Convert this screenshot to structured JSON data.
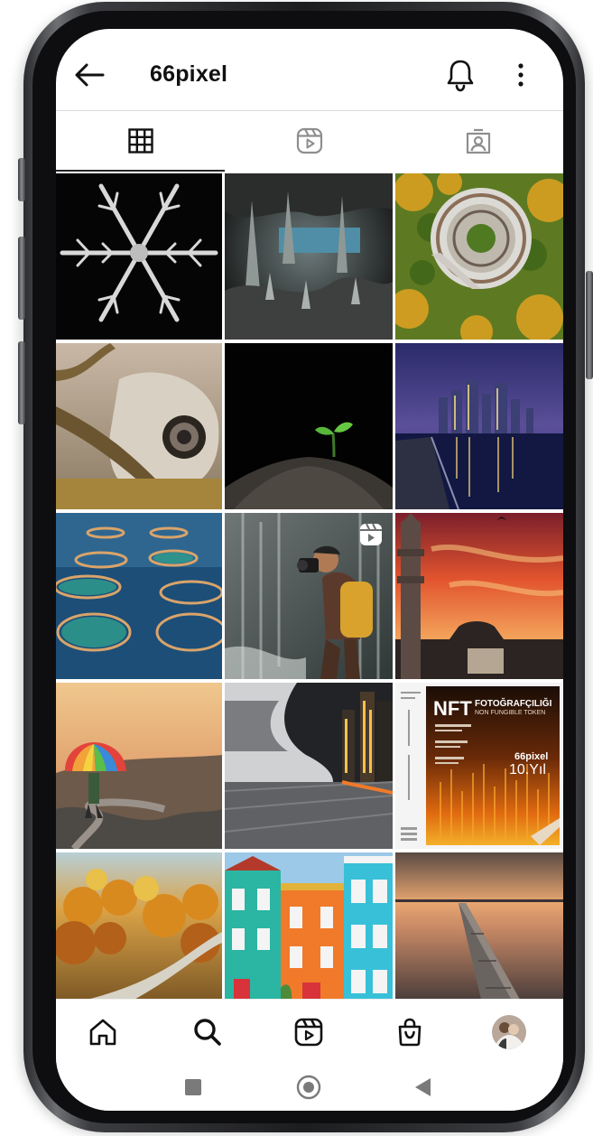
{
  "header": {
    "title": "66pixel",
    "back_icon": "arrow-left-icon",
    "notification_icon": "bell-icon",
    "more_icon": "more-vertical-icon"
  },
  "tabs": [
    {
      "name": "posts-grid",
      "icon": "grid-icon",
      "selected": true
    },
    {
      "name": "reels",
      "icon": "reels-icon",
      "selected": false
    },
    {
      "name": "tagged",
      "icon": "tagged-person-icon",
      "selected": false
    }
  ],
  "grid": {
    "posts": [
      {
        "subject": "snowflake"
      },
      {
        "subject": "underwater-cave"
      },
      {
        "subject": "aerial-round-building"
      },
      {
        "subject": "camouflaged-camera-lens"
      },
      {
        "subject": "seedling-in-dark"
      },
      {
        "subject": "city-skyline-night"
      },
      {
        "subject": "fish-farm-circles"
      },
      {
        "subject": "photographer-waterfall",
        "reel_icon": "reels-icon"
      },
      {
        "subject": "minaret-sunset"
      },
      {
        "subject": "rainbow-umbrella"
      },
      {
        "subject": "modern-architecture-night"
      },
      {
        "subject": "nft-magazine-cover"
      },
      {
        "subject": "autumn-road"
      },
      {
        "subject": "colorful-houses"
      },
      {
        "subject": "pier-sunset"
      }
    ],
    "magazine": {
      "headline": "NFT",
      "headline_rest": "FOTOĞRAFÇILIĞI",
      "subhead": "NON FUNGIBLE TOKEN",
      "brand": "66pixel",
      "anniversary": "10.Yıl"
    }
  },
  "bottom_nav": {
    "items": [
      {
        "name": "home",
        "icon": "home-icon"
      },
      {
        "name": "search",
        "icon": "search-icon"
      },
      {
        "name": "reels",
        "icon": "reels-icon"
      },
      {
        "name": "shop",
        "icon": "shopping-bag-icon"
      },
      {
        "name": "profile",
        "icon": "avatar"
      }
    ]
  },
  "system_bar": {
    "items": [
      "recents-icon",
      "home-circle-icon",
      "back-triangle-icon"
    ]
  },
  "colors": {
    "text": "#111111",
    "divider": "#dbdbdb",
    "frame": "#1c1d1f"
  }
}
